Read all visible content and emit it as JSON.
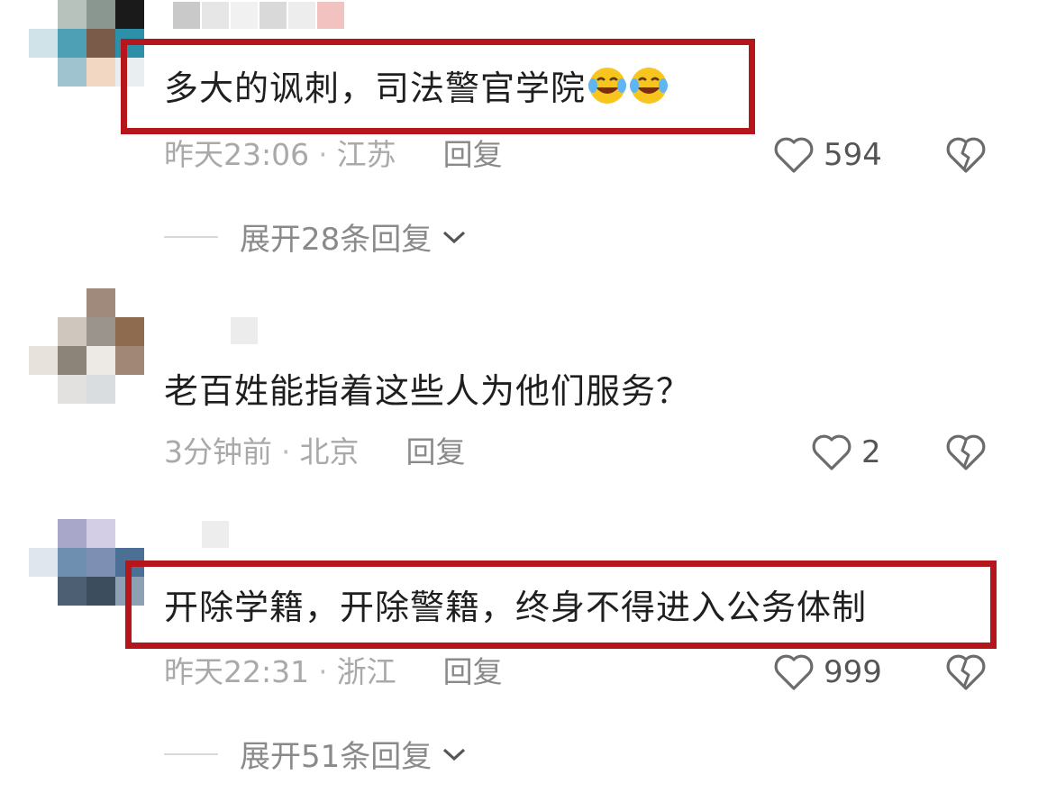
{
  "comments": [
    {
      "text": "多大的讽刺，司法警官学院",
      "emojis": [
        "laughing-crying-emoji",
        "laughing-crying-emoji"
      ],
      "time": "昨天23:06",
      "location": "江苏",
      "reply_label": "回复",
      "likes": "594",
      "expand_label": "展开28条回复",
      "highlighted": true
    },
    {
      "text": "老百姓能指着这些人为他们服务？",
      "time": "3分钟前",
      "location": "北京",
      "reply_label": "回复",
      "likes": "2",
      "highlighted": false
    },
    {
      "text": "开除学籍，开除警籍，终身不得进入公务体制",
      "time": "昨天22:31",
      "location": "浙江",
      "reply_label": "回复",
      "likes": "999",
      "expand_label": "展开51条回复",
      "highlighted": true
    }
  ],
  "separator": "·",
  "colors": {
    "highlight_border": "#b5161b",
    "meta_text": "#a9a9a9",
    "body_text": "#1f1f1f"
  },
  "icons": {
    "like": "heart-outline-icon",
    "dislike": "broken-heart-icon",
    "expand": "chevron-down-icon"
  }
}
